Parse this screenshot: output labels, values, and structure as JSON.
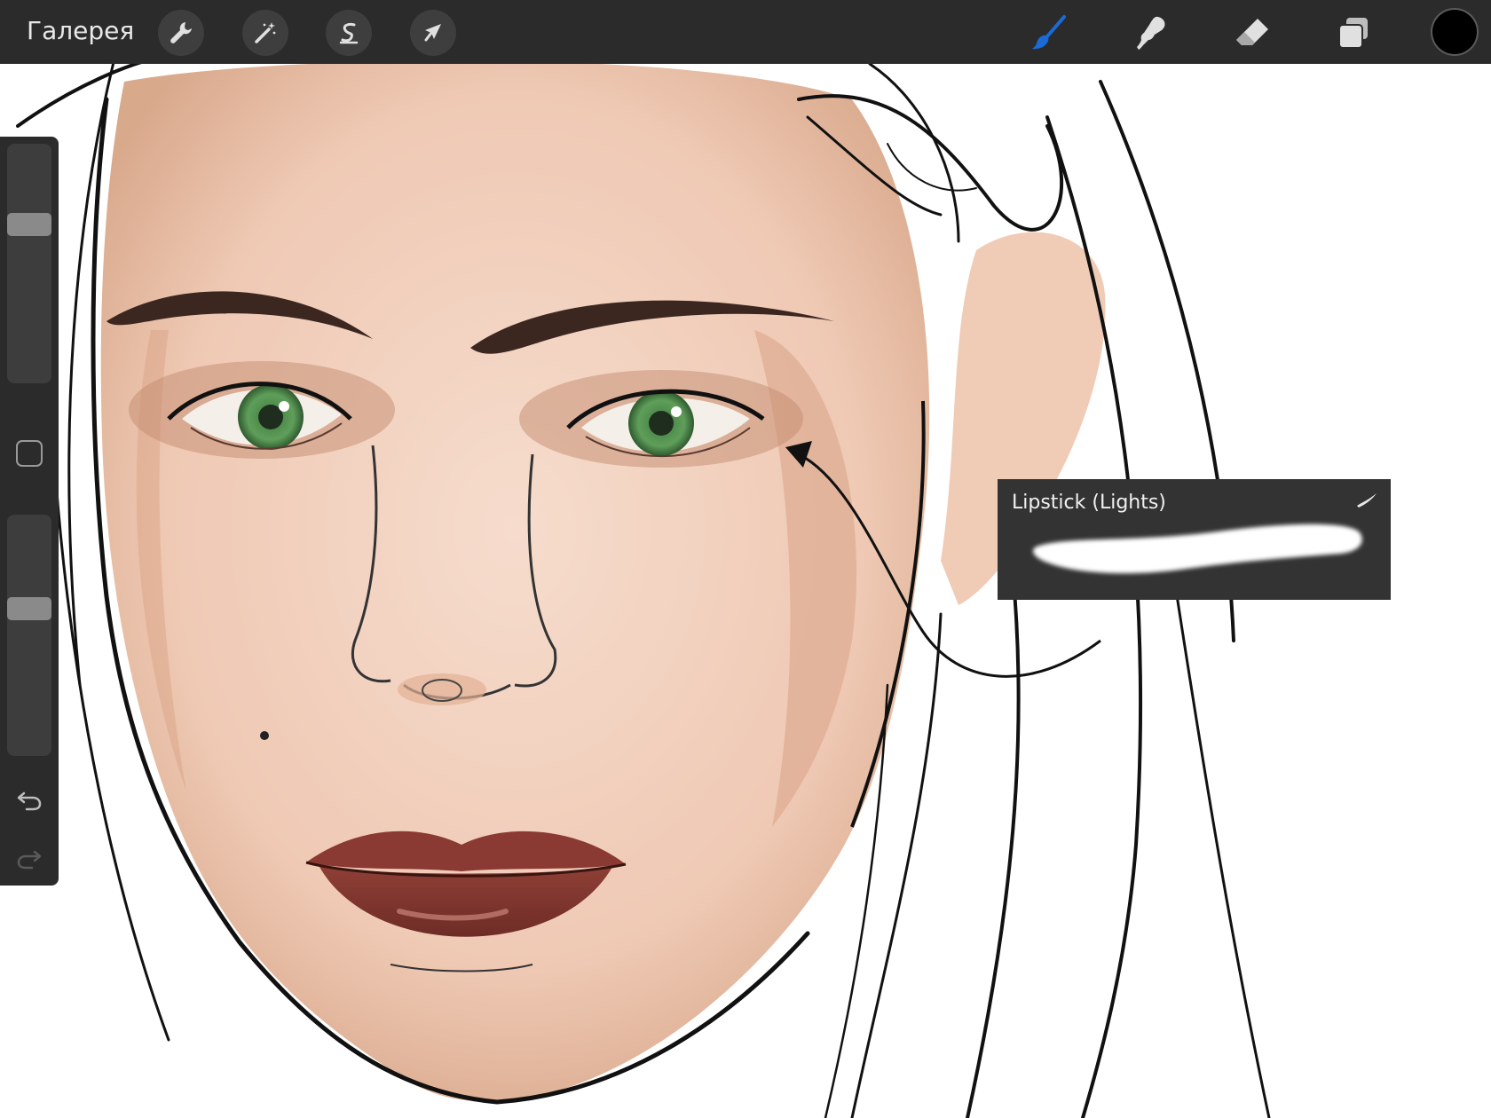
{
  "toolbar": {
    "gallery_label": "Галерея",
    "left_tools": [
      {
        "name": "actions",
        "icon": "wrench-icon"
      },
      {
        "name": "adjustments",
        "icon": "magic-wand-icon"
      },
      {
        "name": "selection",
        "icon": "selection-s-icon"
      },
      {
        "name": "transform",
        "icon": "arrow-cursor-icon"
      }
    ],
    "right_tools": [
      {
        "name": "brush",
        "icon": "brush-icon",
        "active": true
      },
      {
        "name": "smudge",
        "icon": "smudge-icon"
      },
      {
        "name": "eraser",
        "icon": "eraser-icon"
      },
      {
        "name": "layers",
        "icon": "layers-icon"
      }
    ],
    "active_color": "#000000",
    "accent_color": "#1a6bd8"
  },
  "sidebar": {
    "brush_size_level": 0.68,
    "opacity_level": 0.62,
    "modifier_icon": "square-modifier-icon",
    "undo_icon": "undo-icon",
    "redo_icon": "redo-icon"
  },
  "brush_popup": {
    "name": "Lipstick (Lights)",
    "preview_icon": "brush-stroke-preview-icon"
  }
}
